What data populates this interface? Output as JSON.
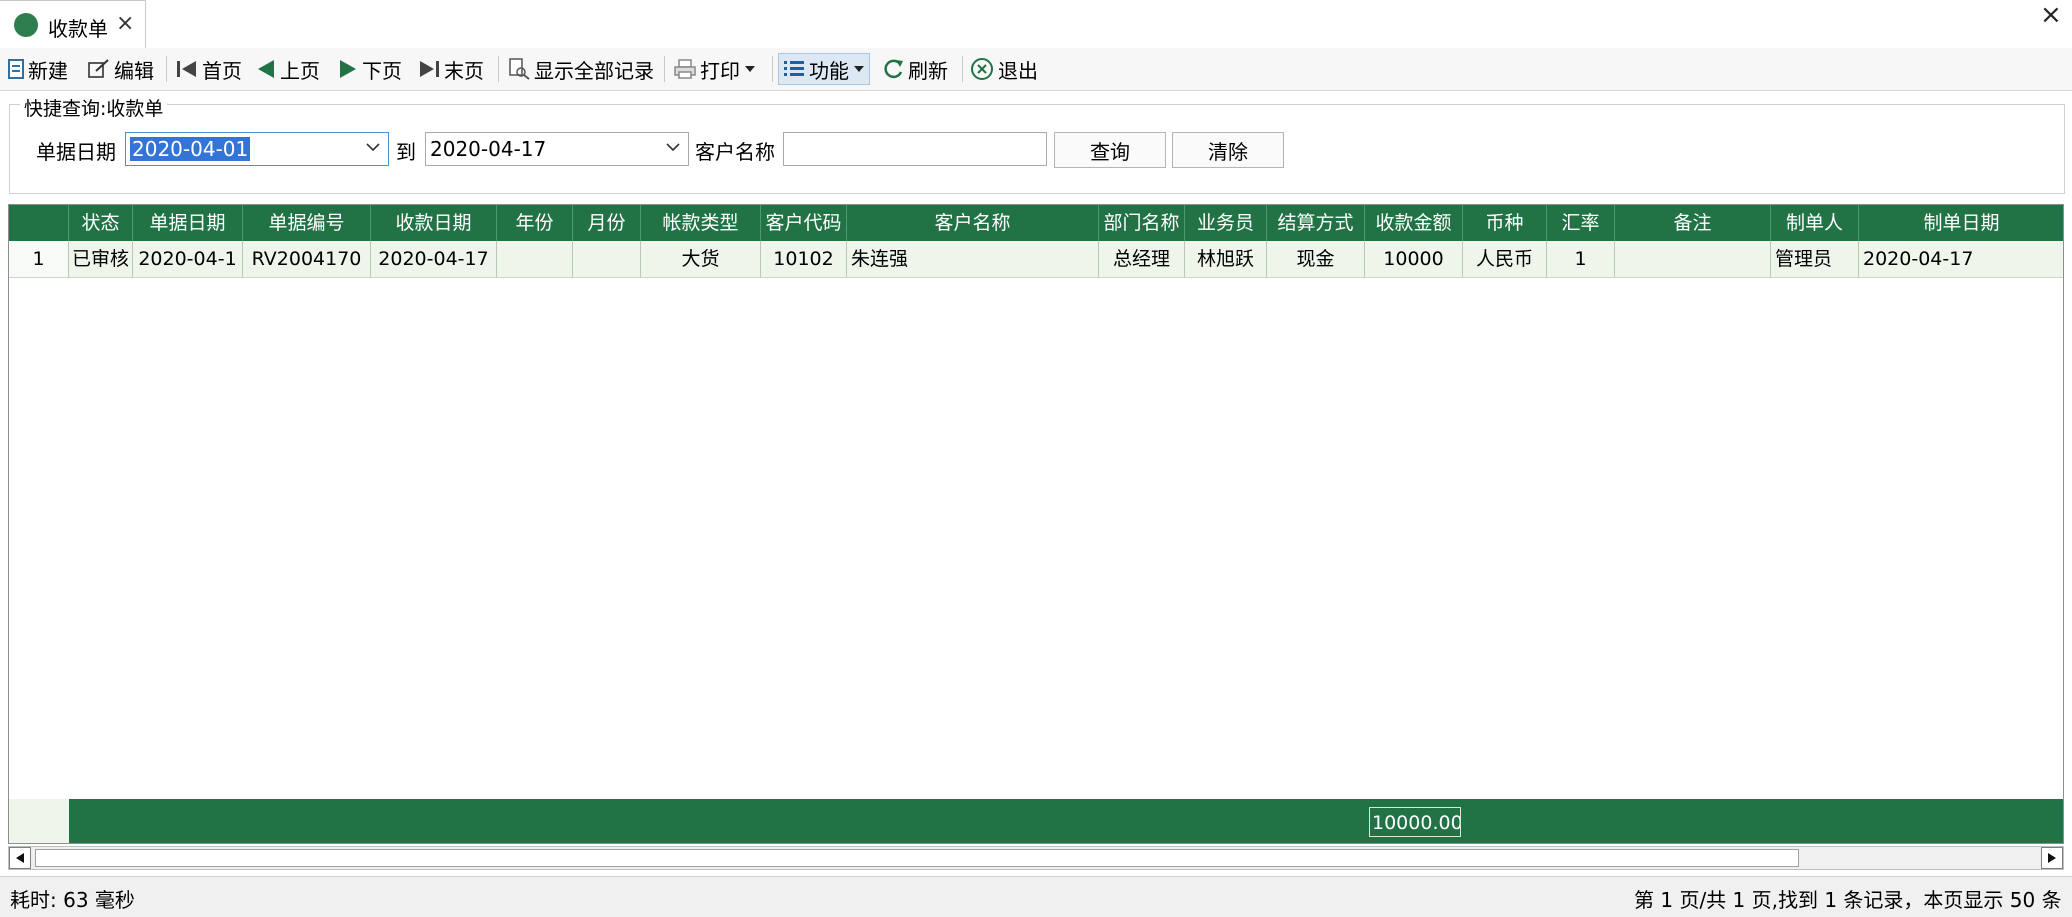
{
  "tab": {
    "title": "收款单",
    "close": "×"
  },
  "window": {
    "close": "×"
  },
  "toolbar": {
    "new": "新建",
    "edit": "编辑",
    "first": "首页",
    "prev": "上页",
    "next": "下页",
    "last": "末页",
    "show_all": "显示全部记录",
    "print": "打印",
    "functions": "功能",
    "refresh": "刷新",
    "exit": "退出"
  },
  "query": {
    "group_title": "快捷查询:收款单",
    "date_label": "单据日期",
    "date_from": "2020-04-01",
    "to_label": "到",
    "date_to": "2020-04-17",
    "customer_label": "客户名称",
    "customer_value": "",
    "search_button": "查询",
    "clear_button": "清除"
  },
  "grid": {
    "columns": [
      "状态",
      "单据日期",
      "单据编号",
      "收款日期",
      "年份",
      "月份",
      "帐款类型",
      "客户代码",
      "客户名称",
      "部门名称",
      "业务员",
      "结算方式",
      "收款金额",
      "币种",
      "汇率",
      "备注",
      "制单人",
      "制单日期"
    ],
    "rows": [
      {
        "index": "1",
        "cells": [
          "已审核",
          "2020-04-1",
          "RV2004170",
          "2020-04-17",
          "",
          "",
          "大货",
          "10102",
          "朱连强",
          "总经理",
          "林旭跃",
          "现金",
          "10000",
          "人民币",
          "1",
          "",
          "管理员",
          "2020-04-17"
        ]
      }
    ],
    "total_amount": "10000.00"
  },
  "status": {
    "elapsed": "耗时: 63 毫秒",
    "page_info": "第 1 页/共 1 页,找到 1 条记录，本页显示 50 条"
  },
  "colors": {
    "grid_header": "#217346",
    "row_bg": "#eef6ec",
    "accent_selection": "#3375d6"
  }
}
